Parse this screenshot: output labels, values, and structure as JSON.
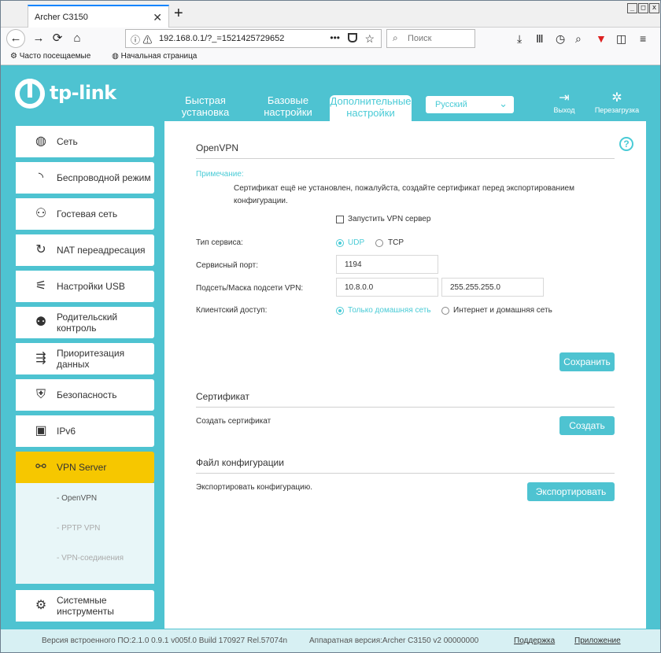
{
  "browser": {
    "tab_title": "Archer C3150",
    "tab_close": "✕",
    "new_tab": "+",
    "url": "192.168.0.1/?_=1521425729652",
    "url_dots": "•••",
    "search_placeholder": "Поиск",
    "bookmarks": [
      "Часто посещаемые",
      "Начальная страница"
    ]
  },
  "header": {
    "logo_text": "tp-link",
    "tabs": [
      "Быстрая установка",
      "Базовые настройки",
      "Дополнительные настройки"
    ],
    "language": "Русский",
    "logout_label": "Выход",
    "reboot_label": "Перезагрузка"
  },
  "sidebar": {
    "items": [
      {
        "label": "Сеть",
        "icon": "globe-icon"
      },
      {
        "label": "Беспроводной режим",
        "icon": "wifi-icon"
      },
      {
        "label": "Гостевая сеть",
        "icon": "guests-icon"
      },
      {
        "label": "NAT переадресация",
        "icon": "nat-icon"
      },
      {
        "label": "Настройки USB",
        "icon": "usb-icon"
      },
      {
        "label": "Родительский контроль",
        "icon": "parental-icon"
      },
      {
        "label": "Приоритезация данных",
        "icon": "qos-icon"
      },
      {
        "label": "Безопасность",
        "icon": "shield-icon"
      },
      {
        "label": "IPv6",
        "icon": "ipv6-icon"
      },
      {
        "label": "VPN Server",
        "icon": "link-icon"
      },
      {
        "label": "Системные инструменты",
        "icon": "gear-icon"
      }
    ],
    "vpn_sub": [
      "- OpenVPN",
      "- PPTP VPN",
      "- VPN-соединения"
    ]
  },
  "openvpn": {
    "title": "OpenVPN",
    "note_label": "Примечание:",
    "note_text": "Сертификат ещё не установлен, пожалуйста, создайте сертификат перед экспортированием конфигурации.",
    "enable_label": "Запустить VPN сервер",
    "service_type_label": "Тип сервиса:",
    "udp": "UDP",
    "tcp": "TCP",
    "port_label": "Сервисный порт:",
    "port_value": "1194",
    "subnet_label": "Подсеть/Маска подсети VPN:",
    "subnet_value": "10.8.0.0",
    "mask_value": "255.255.255.0",
    "client_label": "Клиентский доступ:",
    "client_home": "Только домашняя сеть",
    "client_internet": "Интернет и домашняя сеть",
    "save_btn": "Сохранить"
  },
  "certificate": {
    "title": "Сертификат",
    "create_label": "Создать сертификат",
    "create_btn": "Создать"
  },
  "config": {
    "title": "Файл конфигурации",
    "export_label": "Экспортировать конфигурацию.",
    "export_btn": "Экспортировать"
  },
  "footer": {
    "firmware": "Версия встроенного ПО:2.1.0 0.9.1 v005f.0 Build 170927 Rel.57074n",
    "hardware": "Аппаратная версия:Archer C3150 v2 00000000",
    "support": "Поддержка",
    "app": "Приложение"
  }
}
